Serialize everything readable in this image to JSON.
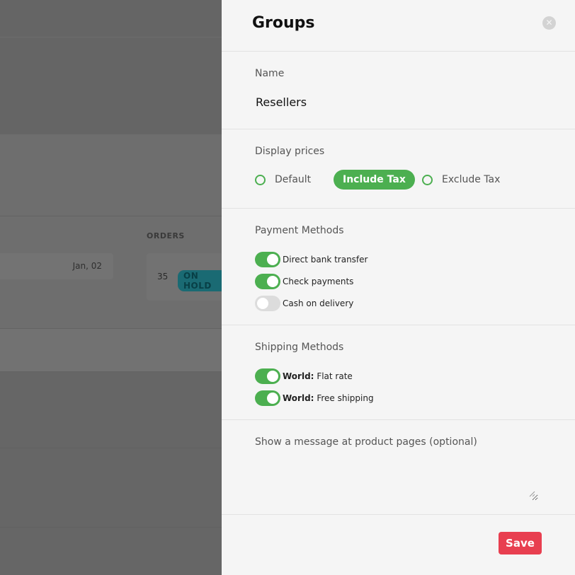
{
  "background": {
    "orders_heading": "ORDERS",
    "row_date": "Jan, 02",
    "order_count": "35",
    "order_status": "ON HOLD"
  },
  "panel": {
    "title": "Groups",
    "close_icon": "close-icon",
    "name_section": {
      "label": "Name",
      "value": "Resellers"
    },
    "display_prices": {
      "label": "Display prices",
      "options": [
        {
          "label": "Default",
          "selected": false
        },
        {
          "label": "Include Tax",
          "selected": true
        },
        {
          "label": "Exclude Tax",
          "selected": false
        }
      ]
    },
    "payment_methods": {
      "label": "Payment Methods",
      "items": [
        {
          "label": "Direct bank transfer",
          "enabled": true
        },
        {
          "label": "Check payments",
          "enabled": true
        },
        {
          "label": "Cash on delivery",
          "enabled": false
        }
      ]
    },
    "shipping_methods": {
      "label": "Shipping Methods",
      "items": [
        {
          "prefix": "World:",
          "label": "Flat rate",
          "enabled": true
        },
        {
          "prefix": "World:",
          "label": "Free shipping",
          "enabled": true
        }
      ]
    },
    "message": {
      "label": "Show a message at product pages (optional)",
      "value": ""
    },
    "save_label": "Save"
  },
  "colors": {
    "accent_green": "#4caf50",
    "save_red": "#e83f50",
    "backdrop": "#6e6e6e"
  }
}
